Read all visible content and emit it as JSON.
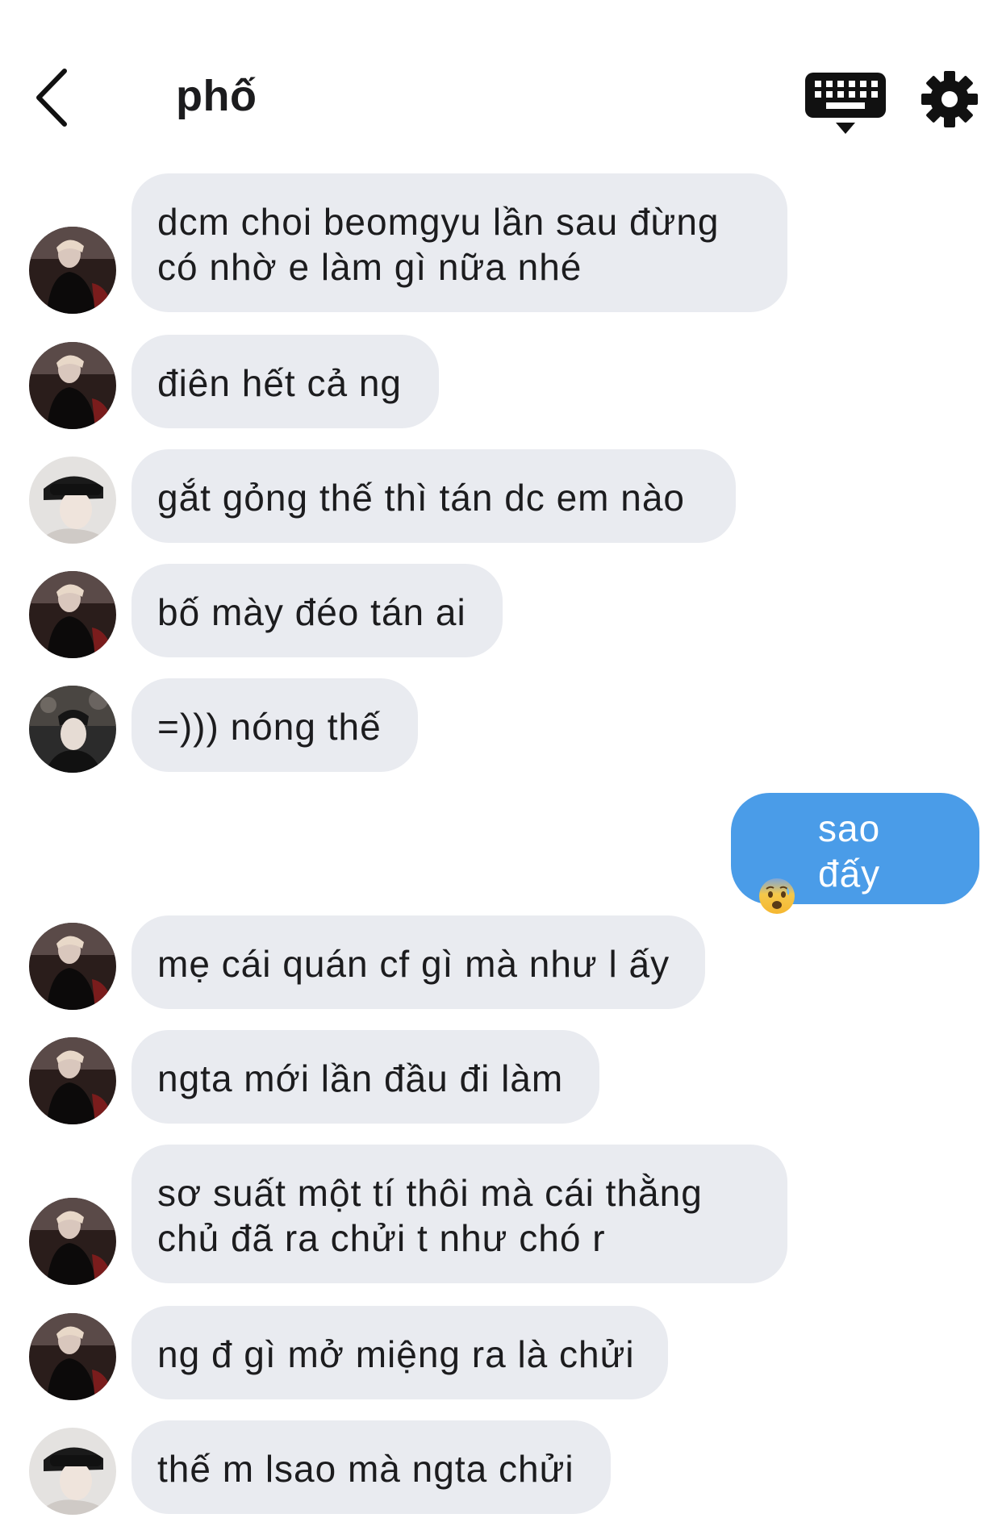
{
  "header": {
    "title": "phố",
    "back_icon": "chevron-left-icon",
    "keyboard_icon": "keyboard-icon",
    "settings_icon": "gear-icon"
  },
  "colors": {
    "incoming_bubble": "#e9ebf0",
    "outgoing_bubble": "#4a9ce8",
    "text": "#1c1c1e"
  },
  "messages": [
    {
      "direction": "in",
      "avatar": "avatar-friend",
      "text": "dcm choi beomgyu lần sau đừng\ncó nhờ e làm gì nữa nhé"
    },
    {
      "direction": "in",
      "avatar": "avatar-friend",
      "text": "điên hết cả ng"
    },
    {
      "direction": "in",
      "avatar": "avatar-headband",
      "text": "gắt gỏng thế thì tán dc em nào"
    },
    {
      "direction": "in",
      "avatar": "avatar-friend",
      "text": "bố mày đéo tán ai"
    },
    {
      "direction": "in",
      "avatar": "avatar-dark",
      "text": "=))) nóng thế"
    },
    {
      "direction": "out",
      "emoji": "anxious-face-emoji",
      "text": "sao đấy"
    },
    {
      "direction": "in",
      "avatar": "avatar-friend",
      "text": "mẹ cái quán cf gì mà như l ấy"
    },
    {
      "direction": "in",
      "avatar": "avatar-friend",
      "text": "ngta mới lần đầu đi làm"
    },
    {
      "direction": "in",
      "avatar": "avatar-friend",
      "text": "sơ suất một tí thôi mà cái thằng\nchủ đã ra chửi t như chó r"
    },
    {
      "direction": "in",
      "avatar": "avatar-friend",
      "text": "ng đ gì mở miệng ra là chửi"
    },
    {
      "direction": "in",
      "avatar": "avatar-headband",
      "text": "thế m lsao mà ngta chửi"
    }
  ]
}
